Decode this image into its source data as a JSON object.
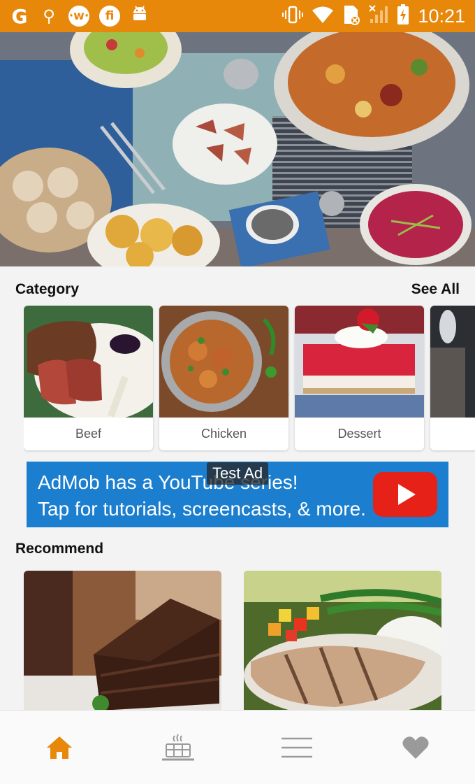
{
  "status_bar": {
    "left_icons": [
      "google-icon",
      "usb-icon",
      "w-app-icon",
      "fi-app-icon",
      "android-icon"
    ],
    "right_icons": [
      "vibrate-icon",
      "wifi-icon",
      "sim-icon",
      "signal-icon",
      "battery-charging-icon"
    ],
    "time": "10:21"
  },
  "hero": {
    "image": "food-spread-photo"
  },
  "category": {
    "title": "Category",
    "see_all_label": "See All",
    "items": [
      {
        "label": "Beef",
        "image": "beef-photo"
      },
      {
        "label": "Chicken",
        "image": "chicken-curry-photo"
      },
      {
        "label": "Dessert",
        "image": "dessert-photo"
      },
      {
        "label": "",
        "image": "partial-photo"
      }
    ]
  },
  "ad": {
    "line1": "AdMob has a YouTube series!",
    "line2": "Tap for tutorials, screencasts, & more.",
    "badge": "Test Ad",
    "icon": "youtube-play-icon"
  },
  "recommend": {
    "title": "Recommend",
    "items": [
      {
        "image": "chocolate-cake-photo"
      },
      {
        "image": "grilled-fish-photo"
      }
    ]
  },
  "bottom_nav": {
    "items": [
      {
        "icon": "home-icon",
        "active": true
      },
      {
        "icon": "food-tray-icon",
        "active": false
      },
      {
        "icon": "menu-icon",
        "active": false
      },
      {
        "icon": "heart-icon",
        "active": false
      }
    ]
  },
  "colors": {
    "accent": "#e8880b",
    "ad_background": "#1c7ecf",
    "nav_inactive": "#9a9a9a"
  }
}
